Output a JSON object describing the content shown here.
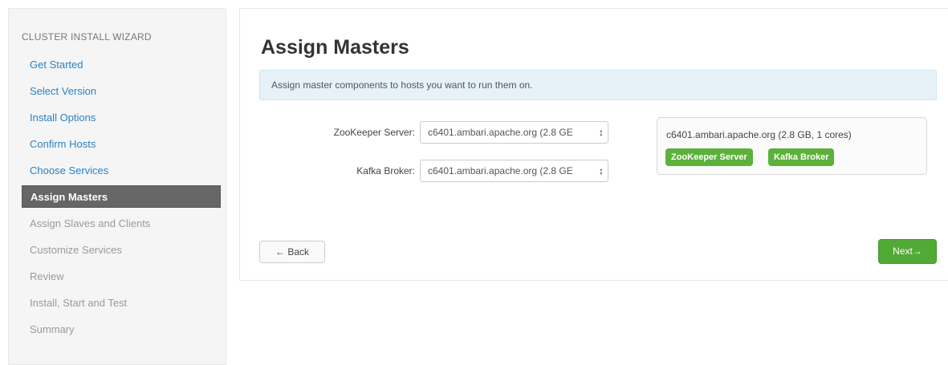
{
  "sidebar": {
    "heading": "CLUSTER INSTALL WIZARD",
    "items": [
      {
        "label": "Get Started",
        "state": "done"
      },
      {
        "label": "Select Version",
        "state": "done"
      },
      {
        "label": "Install Options",
        "state": "done"
      },
      {
        "label": "Confirm Hosts",
        "state": "done"
      },
      {
        "label": "Choose Services",
        "state": "done"
      },
      {
        "label": "Assign Masters",
        "state": "active"
      },
      {
        "label": "Assign Slaves and Clients",
        "state": "pending"
      },
      {
        "label": "Customize Services",
        "state": "pending"
      },
      {
        "label": "Review",
        "state": "pending"
      },
      {
        "label": "Install, Start and Test",
        "state": "pending"
      },
      {
        "label": "Summary",
        "state": "pending"
      }
    ]
  },
  "main": {
    "title": "Assign Masters",
    "info": "Assign master components to hosts you want to run them on.",
    "assignments": [
      {
        "label": "ZooKeeper Server:",
        "value": "c6401.ambari.apache.org (2.8 GB, 1 cores)",
        "display": "c6401.ambari.apache.org (2.8 GE"
      },
      {
        "label": "Kafka Broker:",
        "value": "c6401.ambari.apache.org (2.8 GB, 1 cores)",
        "display": "c6401.ambari.apache.org (2.8 GE"
      }
    ],
    "host_panel": {
      "host": "c6401.ambari.apache.org (2.8 GB, 1 cores)",
      "components": [
        "ZooKeeper Server",
        "Kafka Broker"
      ]
    },
    "back_label": "← Back",
    "next_label": "Next→"
  },
  "colors": {
    "link": "#2a82c6",
    "active_bg": "#666666",
    "badge": "#5cb13a",
    "next_button": "#51aa35",
    "alert_bg": "#e6f2f7"
  },
  "icons": {
    "select_caret": "updown-caret-icon"
  }
}
